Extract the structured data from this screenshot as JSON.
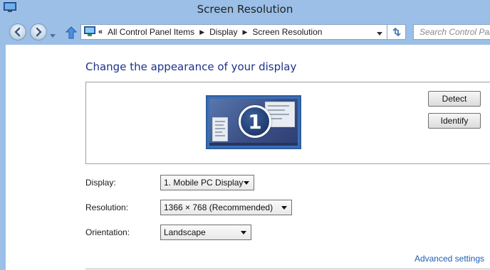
{
  "window": {
    "title": "Screen Resolution"
  },
  "address": {
    "crumbs": [
      "All Control Panel Items",
      "Display",
      "Screen Resolution"
    ]
  },
  "search": {
    "placeholder": "Search Control Panel"
  },
  "main": {
    "heading": "Change the appearance of your display",
    "monitor_number": "1",
    "detect_label": "Detect",
    "identify_label": "Identify",
    "display_label": "Display:",
    "display_value": "1. Mobile PC Display",
    "resolution_label": "Resolution:",
    "resolution_value": "1366 × 768 (Recommended)",
    "orientation_label": "Orientation:",
    "orientation_value": "Landscape",
    "advanced_link": "Advanced settings"
  }
}
